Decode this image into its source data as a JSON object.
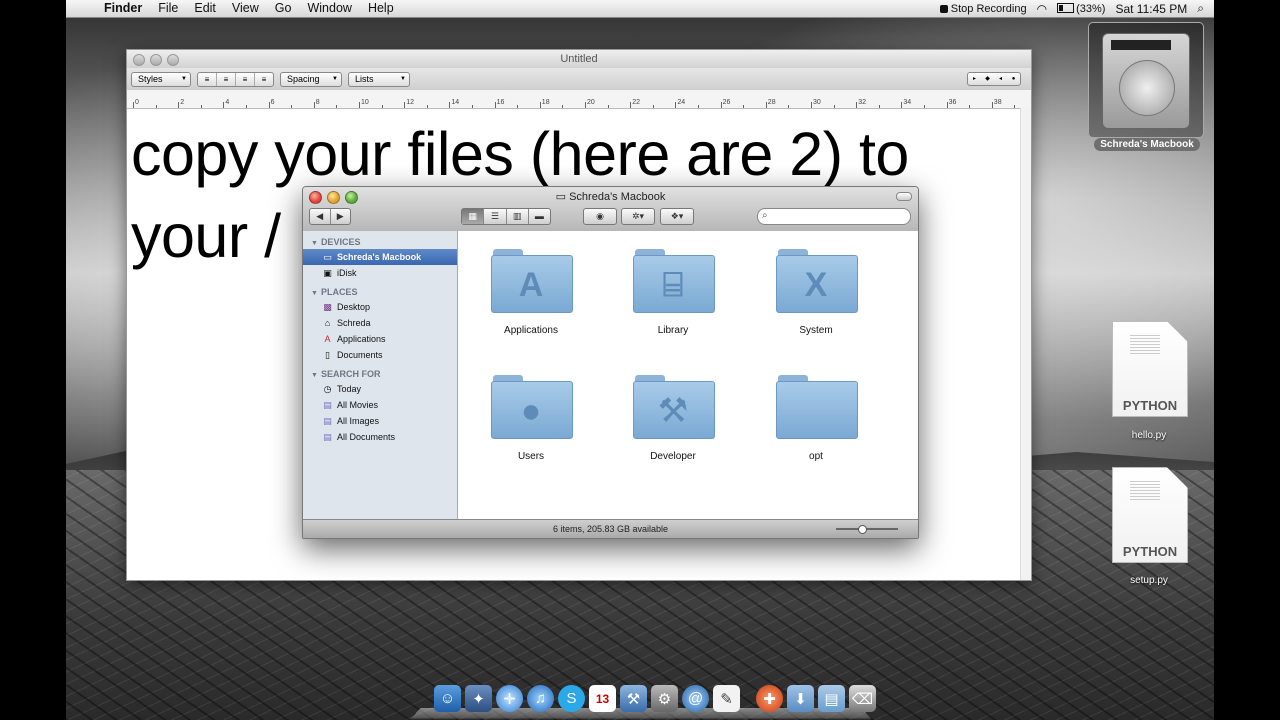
{
  "menubar": {
    "app": "Finder",
    "items": [
      "File",
      "Edit",
      "View",
      "Go",
      "Window",
      "Help"
    ],
    "stop_recording": "Stop Recording",
    "battery": "(33%)",
    "clock": "Sat 11:45 PM"
  },
  "textedit": {
    "title": "Untitled",
    "styles": "Styles",
    "spacing": "Spacing",
    "lists": "Lists",
    "line1": "copy your files (here are 2) to",
    "line2": "your /",
    "ruler_labels": [
      "0",
      "2",
      "4",
      "6",
      "8",
      "10",
      "12",
      "14",
      "16",
      "18",
      "20",
      "22",
      "24",
      "26",
      "28",
      "30",
      "32",
      "34",
      "36",
      "38"
    ]
  },
  "finder": {
    "title": "Schreda's Macbook",
    "search_placeholder": "",
    "devices_header": "DEVICES",
    "devices": [
      "Schreda's Macbook",
      "iDisk"
    ],
    "places_header": "PLACES",
    "places": [
      "Desktop",
      "Schreda",
      "Applications",
      "Documents"
    ],
    "search_header": "SEARCH FOR",
    "search_for": [
      "Today",
      "All Movies",
      "All Images",
      "All Documents"
    ],
    "folders": [
      "Applications",
      "Library",
      "System",
      "Users",
      "Developer",
      "opt"
    ],
    "status": "6 items, 205.83 GB available"
  },
  "desktop": {
    "hd_name": "Schreda's Macbook",
    "file1": "hello.py",
    "file2": "setup.py",
    "file_badge": "PYTHON"
  },
  "icons": {
    "apple": "apple-icon",
    "wifi": "wifi-icon",
    "search": "search-icon"
  }
}
